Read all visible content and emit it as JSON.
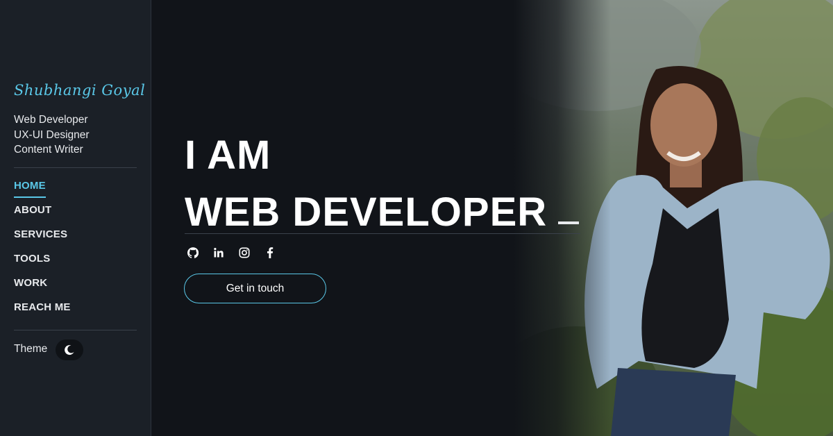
{
  "sidebar": {
    "brand": "Shubhangi Goyal",
    "roles": [
      "Web Developer",
      "UX-UI Designer",
      "Content Writer"
    ],
    "nav": [
      "HOME",
      "ABOUT",
      "SERVICES",
      "TOOLS",
      "WORK",
      "REACH ME"
    ],
    "active_nav": "HOME",
    "theme_label": "Theme",
    "theme_icon": "moon-icon"
  },
  "hero": {
    "line1": "I AM",
    "line2": "WEB DEVELOPER",
    "socials": [
      "github-icon",
      "linkedin-icon",
      "instagram-icon",
      "facebook-icon"
    ],
    "cta_label": "Get in touch"
  },
  "colors": {
    "accent": "#5ac8e8",
    "background": "#111419",
    "sidebar": "#1b2027"
  }
}
